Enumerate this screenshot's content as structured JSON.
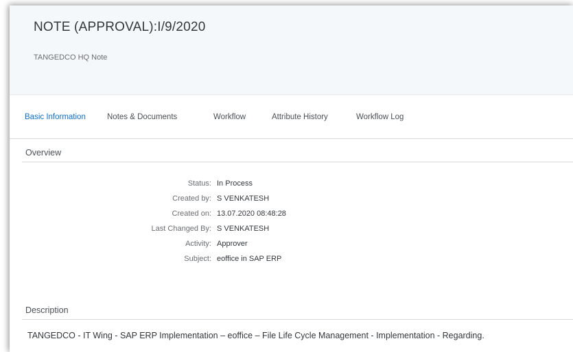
{
  "header": {
    "title": "NOTE (APPROVAL):I/9/2020",
    "subtitle": "TANGEDCO HQ Note"
  },
  "tabs": [
    {
      "label": "Basic Information",
      "active": true
    },
    {
      "label": "Notes & Documents",
      "active": false
    },
    {
      "label": "Workflow",
      "active": false
    },
    {
      "label": "Attribute History",
      "active": false
    },
    {
      "label": "Workflow Log",
      "active": false
    }
  ],
  "overview": {
    "title": "Overview",
    "fields": [
      {
        "label": "Status:",
        "value": "In Process"
      },
      {
        "label": "Created by:",
        "value": "S VENKATESH"
      },
      {
        "label": "Created on:",
        "value": "13.07.2020 08:48:28"
      },
      {
        "label": "Last Changed By:",
        "value": "S VENKATESH"
      },
      {
        "label": "Activity:",
        "value": "Approver"
      },
      {
        "label": "Subject:",
        "value": "eoffice in SAP ERP"
      }
    ]
  },
  "description": {
    "title": "Description",
    "text": "TANGEDCO - IT Wing - SAP ERP Implementation – eoffice – File Life Cycle Management - Implementation - Regarding."
  },
  "colors": {
    "accent": "#0a6ed1",
    "header_bg": "#f5f8fb",
    "text": "#32363a",
    "label": "#6a6d70"
  }
}
